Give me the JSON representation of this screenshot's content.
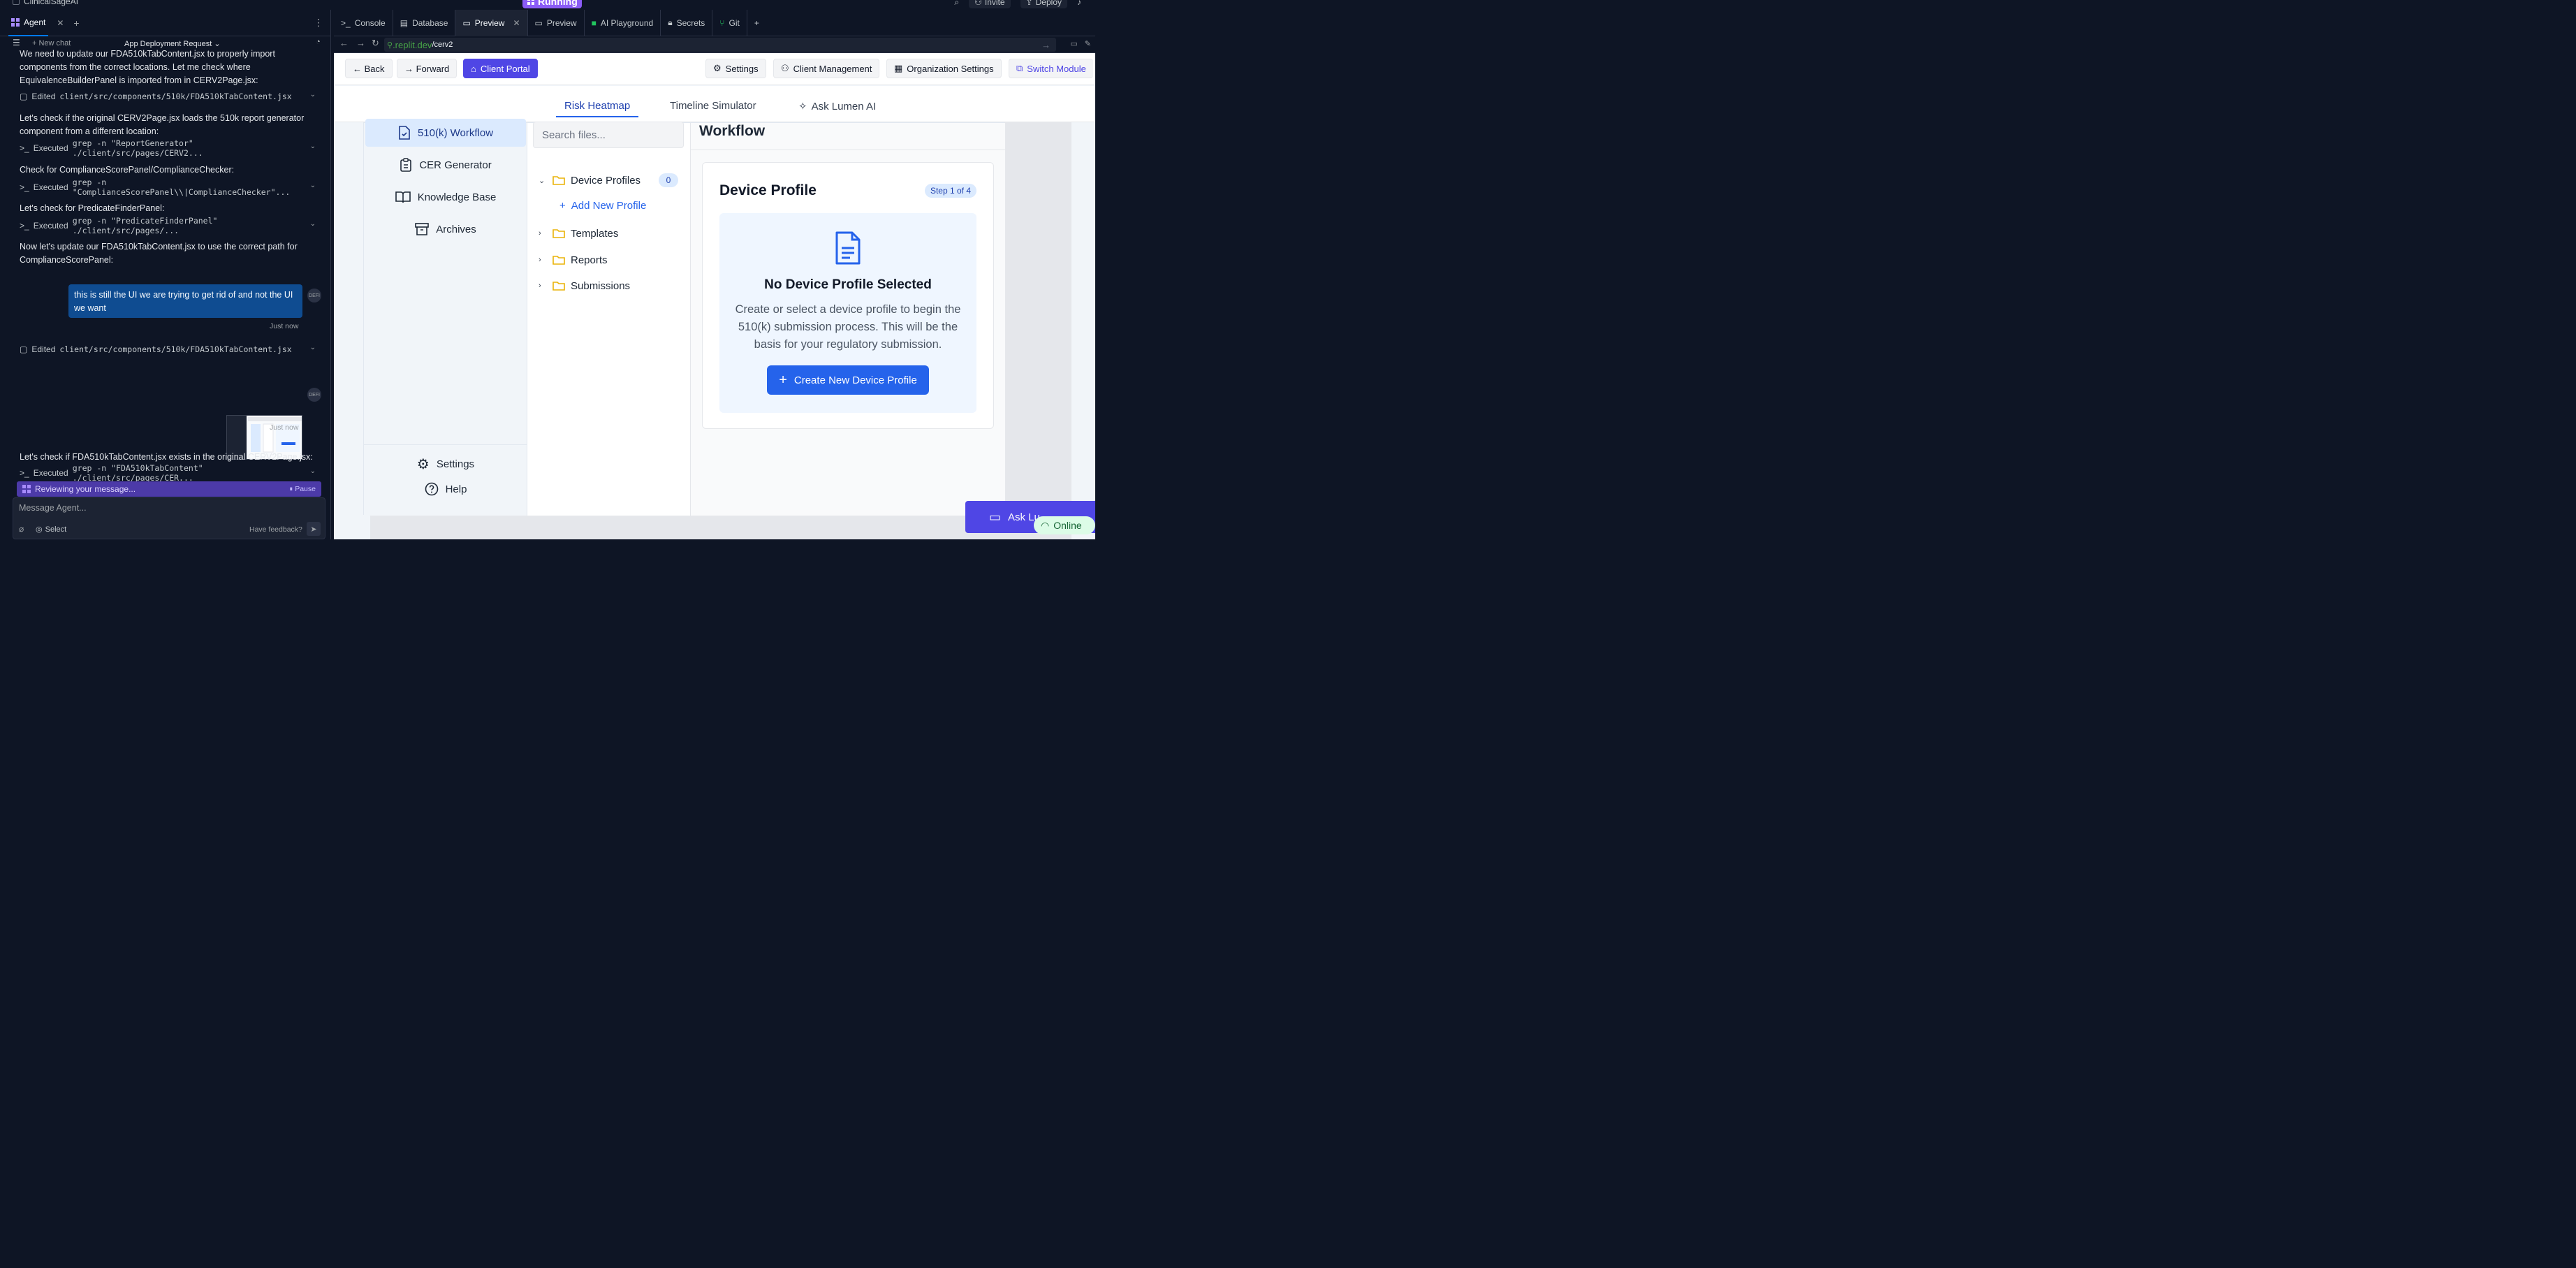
{
  "topbar": {
    "app_name": "ClinicalSageAI",
    "status": "Running",
    "invite": "Invite",
    "deploy": "Deploy"
  },
  "agent_panel": {
    "tab_label": "Agent",
    "new_chat": "+ New chat",
    "thread_title": "App Deployment Request",
    "messages": {
      "m1": "We need to update our FDA510kTabContent.jsx to properly import components from the correct locations. Let me check where EquivalenceBuilderPanel is imported from in CERV2Page.jsx:",
      "a1_prefix": "Edited",
      "a1_code": "client/src/components/510k/FDA510kTabContent.jsx",
      "m2": "Let's check if the original CERV2Page.jsx loads the 510k report generator component from a different location:",
      "a2_prefix": "Executed",
      "a2_code": "grep -n \"ReportGenerator\" ./client/src/pages/CERV2...",
      "m3": "Check for ComplianceScorePanel/ComplianceChecker:",
      "a3_prefix": "Executed",
      "a3_code": "grep -n \"ComplianceScorePanel\\\\|ComplianceChecker\"...",
      "m4": "Let's check for PredicateFinderPanel:",
      "a4_prefix": "Executed",
      "a4_code": "grep -n \"PredicateFinderPanel\" ./client/src/pages/...",
      "m5": "Now let's update our FDA510kTabContent.jsx to use the correct path for ComplianceScorePanel:",
      "user1": "this is still the UI we are trying to get rid of and not the UI we want",
      "ts1": "Just now",
      "a5_prefix": "Edited",
      "a5_code": "client/src/components/510k/FDA510kTabContent.jsx",
      "ts2": "Just now",
      "m6": "Let's check if FDA510kTabContent.jsx exists in the original CERV2Page.jsx:",
      "a6_prefix": "Executed",
      "a6_code": "grep -n \"FDA510kTabContent\" ./client/src/pages/CER...",
      "avatar": "DEFI"
    },
    "reviewing": "Reviewing your message...",
    "pause": "Pause",
    "composer_placeholder": "Message Agent...",
    "select": "Select",
    "feedback": "Have feedback?"
  },
  "workspace_tabs": [
    {
      "label": "Console"
    },
    {
      "label": "Database"
    },
    {
      "label": "Preview"
    },
    {
      "label": "Preview"
    },
    {
      "label": "AI Playground"
    },
    {
      "label": "Secrets"
    },
    {
      "label": "Git"
    }
  ],
  "url": {
    "host": ".replit.dev",
    "path": "/cerv2"
  },
  "app": {
    "back": "← Back",
    "forward": "→ Forward",
    "client_portal": "Client Portal",
    "settings": "Settings",
    "client_management": "Client Management",
    "org_settings": "Organization Settings",
    "switch_module": "Switch Module",
    "subnav": {
      "risk": "Risk Heatmap",
      "timeline": "Timeline Simulator",
      "ask": "Ask Lumen AI"
    },
    "sidebar": {
      "workflow": "510(k) Workflow",
      "cer": "CER Generator",
      "kb": "Knowledge Base",
      "archives": "Archives",
      "settings": "Settings",
      "help": "Help"
    },
    "files": {
      "search_placeholder": "Search files...",
      "device_profiles": "Device Profiles",
      "device_profiles_count": "0",
      "add_profile": "Add New Profile",
      "templates": "Templates",
      "reports": "Reports",
      "submissions": "Submissions"
    },
    "workflow": {
      "title": "Workflow",
      "card_title": "Device Profile",
      "step": "Step 1 of 4",
      "empty_title": "No Device Profile Selected",
      "empty_text": "Create or select a device profile to begin the 510(k) submission process. This will be the basis for your regulatory submission.",
      "create_button": "Create New Device Profile"
    },
    "ask_lumen": "Ask Lu",
    "online": "Online"
  },
  "colors": {
    "accent": "#4f46e5",
    "primary_blue": "#2563eb",
    "replit_dark": "#0e1525"
  }
}
